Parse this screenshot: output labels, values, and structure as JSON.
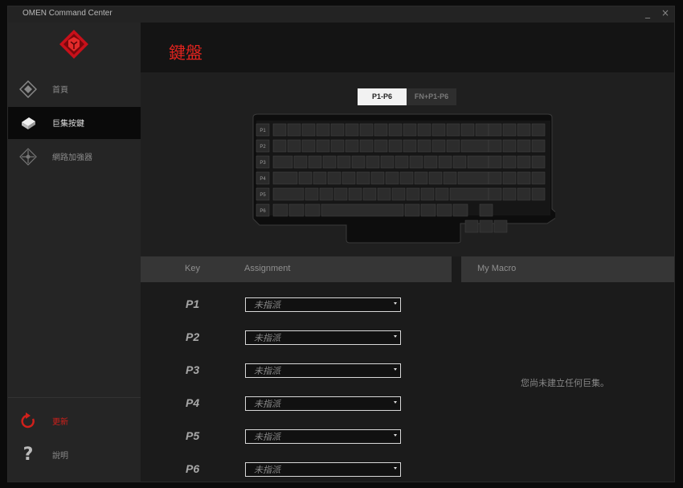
{
  "app": {
    "title": "OMEN Command Center",
    "minimize": "_",
    "close": "×"
  },
  "sidebar": {
    "items": [
      {
        "label": "首頁",
        "icon": "home-diamond-icon"
      },
      {
        "label": "巨集按鍵",
        "icon": "macro-key-icon"
      },
      {
        "label": "網路加強器",
        "icon": "network-booster-icon"
      }
    ],
    "bottom": [
      {
        "label": "更新",
        "icon": "refresh-icon"
      },
      {
        "label": "說明",
        "icon": "help-icon"
      }
    ]
  },
  "collapse_glyph": "‹",
  "header": {
    "title": "鍵盤"
  },
  "keyboard": {
    "tabs": [
      "P1-P6",
      "FN+P1-P6"
    ],
    "active_tab": "P1-P6",
    "side_keys": [
      "P1",
      "P2",
      "P3",
      "P4",
      "P5",
      "P6"
    ]
  },
  "table": {
    "col_key": "Key",
    "col_assignment": "Assignment",
    "col_macro": "My Macro",
    "rows": [
      {
        "key": "P1",
        "value": "未指派"
      },
      {
        "key": "P2",
        "value": "未指派"
      },
      {
        "key": "P3",
        "value": "未指派"
      },
      {
        "key": "P4",
        "value": "未指派"
      },
      {
        "key": "P5",
        "value": "未指派"
      },
      {
        "key": "P6",
        "value": "未指派"
      }
    ],
    "empty_macro": "您尚未建立任何巨集。"
  },
  "colors": {
    "accent": "#e0231e",
    "sidebar": "#252525",
    "active": "#0a0a0a"
  }
}
